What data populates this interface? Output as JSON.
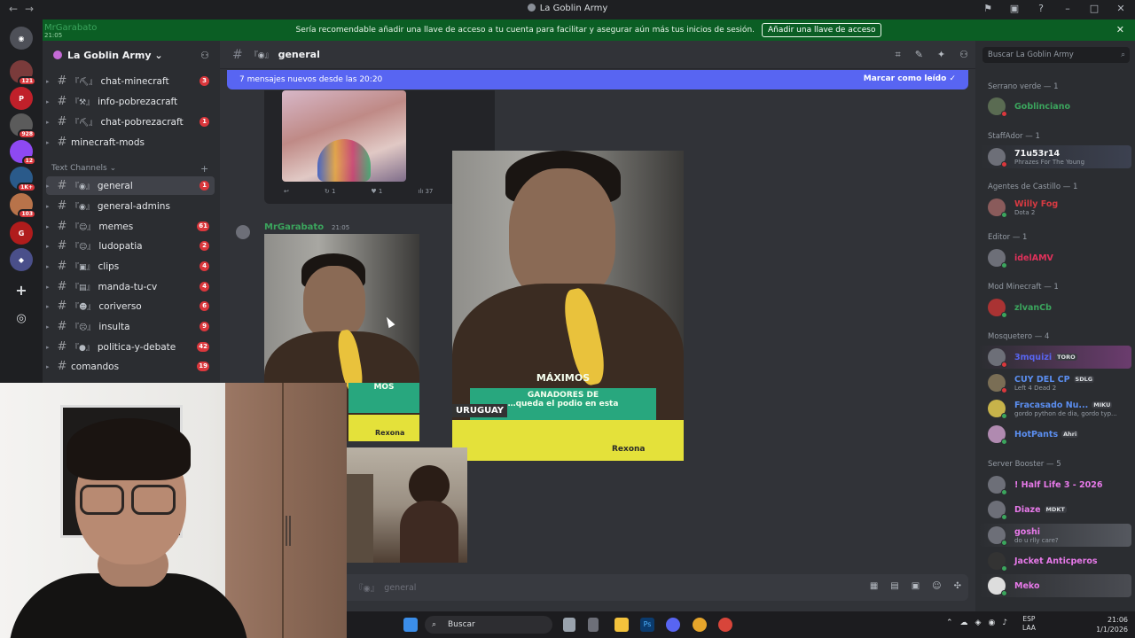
{
  "window": {
    "title": "La Goblin Army"
  },
  "notice": {
    "user": "MrGarabato",
    "user_time": "21:05",
    "text": "Sería recomendable añadir una llave de acceso a tu cuenta para facilitar y asegurar aún más tus inicios de sesión.",
    "button": "Añadir una llave de acceso"
  },
  "rail": {
    "badges": [
      "121",
      "",
      "928",
      "12",
      "1K+",
      "103"
    ]
  },
  "guild": {
    "name": "La Goblin Army"
  },
  "channels_top": [
    {
      "prefix": "『⛏』",
      "name": "chat-minecraft",
      "count": "3"
    },
    {
      "prefix": "『⚒』",
      "name": "info-pobrezacraft",
      "count": ""
    },
    {
      "prefix": "『⛏』",
      "name": "chat-pobrezacraft",
      "count": "1"
    },
    {
      "prefix": "",
      "name": "minecraft-mods",
      "count": ""
    }
  ],
  "category": "Text Channels",
  "channels": [
    {
      "prefix": "『◉』",
      "name": "general",
      "count": "1"
    },
    {
      "prefix": "『◉』",
      "name": "general-admins",
      "count": ""
    },
    {
      "prefix": "『☺』",
      "name": "memes",
      "count": "61"
    },
    {
      "prefix": "『☺』",
      "name": "ludopatia",
      "count": "2"
    },
    {
      "prefix": "『▣』",
      "name": "clips",
      "count": "4"
    },
    {
      "prefix": "『▤』",
      "name": "manda-tu-cv",
      "count": "4"
    },
    {
      "prefix": "『☻』",
      "name": "coriverso",
      "count": "6"
    },
    {
      "prefix": "『☹』",
      "name": "insulta",
      "count": "9"
    },
    {
      "prefix": "『●』",
      "name": "politica-y-debate",
      "count": "42"
    },
    {
      "prefix": "",
      "name": "comandos",
      "count": "19"
    }
  ],
  "chat": {
    "channel_prefix": "『◉』",
    "channel": "general",
    "new_messages": "7 mensajes nuevos desde las 20:20",
    "mark_read": "Marcar como leído",
    "embed_actions": [
      "↩",
      "↻ 1",
      "♥ 1",
      "ılı 37"
    ],
    "message": {
      "author": "MrGarabato",
      "time": "21:05"
    },
    "video": {
      "overlay_small": "MOS",
      "line1": "MÁXIMOS",
      "line2": "GANADORES DE",
      "line3": "…queda el podio en esta",
      "country": "URUGUAY",
      "brand": "Rexona"
    },
    "composer_placeholder": "general"
  },
  "members": {
    "search_placeholder": "Buscar La Goblin Army",
    "groups": [
      {
        "role": "Serrano verde — 1",
        "items": [
          {
            "name": "Goblinciano",
            "color": "#3ba55d",
            "sub": "",
            "tag": ""
          }
        ]
      },
      {
        "role": "StaffAdor — 1",
        "items": [
          {
            "name": "71u53r14",
            "color": "#f2f3f5",
            "sub": "Phrazes For The Young",
            "tag": ""
          }
        ]
      },
      {
        "role": "Agentes de Castillo — 1",
        "items": [
          {
            "name": "Willy Fog",
            "color": "#d83a42",
            "sub": "Dota 2",
            "tag": ""
          }
        ]
      },
      {
        "role": "Editor — 1",
        "items": [
          {
            "name": "idelAMV",
            "color": "#e0315b",
            "sub": "",
            "tag": ""
          }
        ]
      },
      {
        "role": "Mod Minecraft — 1",
        "items": [
          {
            "name": "zlvanCb",
            "color": "#3ba55d",
            "sub": "",
            "tag": ""
          }
        ]
      },
      {
        "role": "Mosquetero — 4",
        "items": [
          {
            "name": "3mquizi",
            "color": "#5865f2",
            "sub": "",
            "tag": "TORO"
          },
          {
            "name": "CUY DEL CP",
            "color": "#5b8ef0",
            "sub": "Left 4 Dead 2",
            "tag": "SDLG"
          },
          {
            "name": "Fracasado Nu...",
            "color": "#5b8ef0",
            "sub": "gordo python de dia, gordo typ...",
            "tag": "MIKU"
          },
          {
            "name": "HotPants",
            "color": "#5b8ef0",
            "sub": "",
            "tag": "Ahri"
          }
        ]
      },
      {
        "role": "Server Booster — 5",
        "items": [
          {
            "name": "! Half Life 3 - 2026",
            "color": "#e779e9",
            "sub": "",
            "tag": ""
          },
          {
            "name": "Diaze",
            "color": "#e779e9",
            "sub": "",
            "tag": "MDKT"
          },
          {
            "name": "goshi",
            "color": "#e779e9",
            "sub": "do u rlly care?",
            "tag": ""
          },
          {
            "name": "Jacket Anticperos",
            "color": "#e779e9",
            "sub": "",
            "tag": ""
          },
          {
            "name": "Meko",
            "color": "#e779e9",
            "sub": "",
            "tag": ""
          }
        ]
      }
    ]
  },
  "taskbar": {
    "search": "Buscar",
    "lang": "ESP",
    "lang2": "LAA",
    "time": "21:06",
    "date": "1/1/2026"
  }
}
